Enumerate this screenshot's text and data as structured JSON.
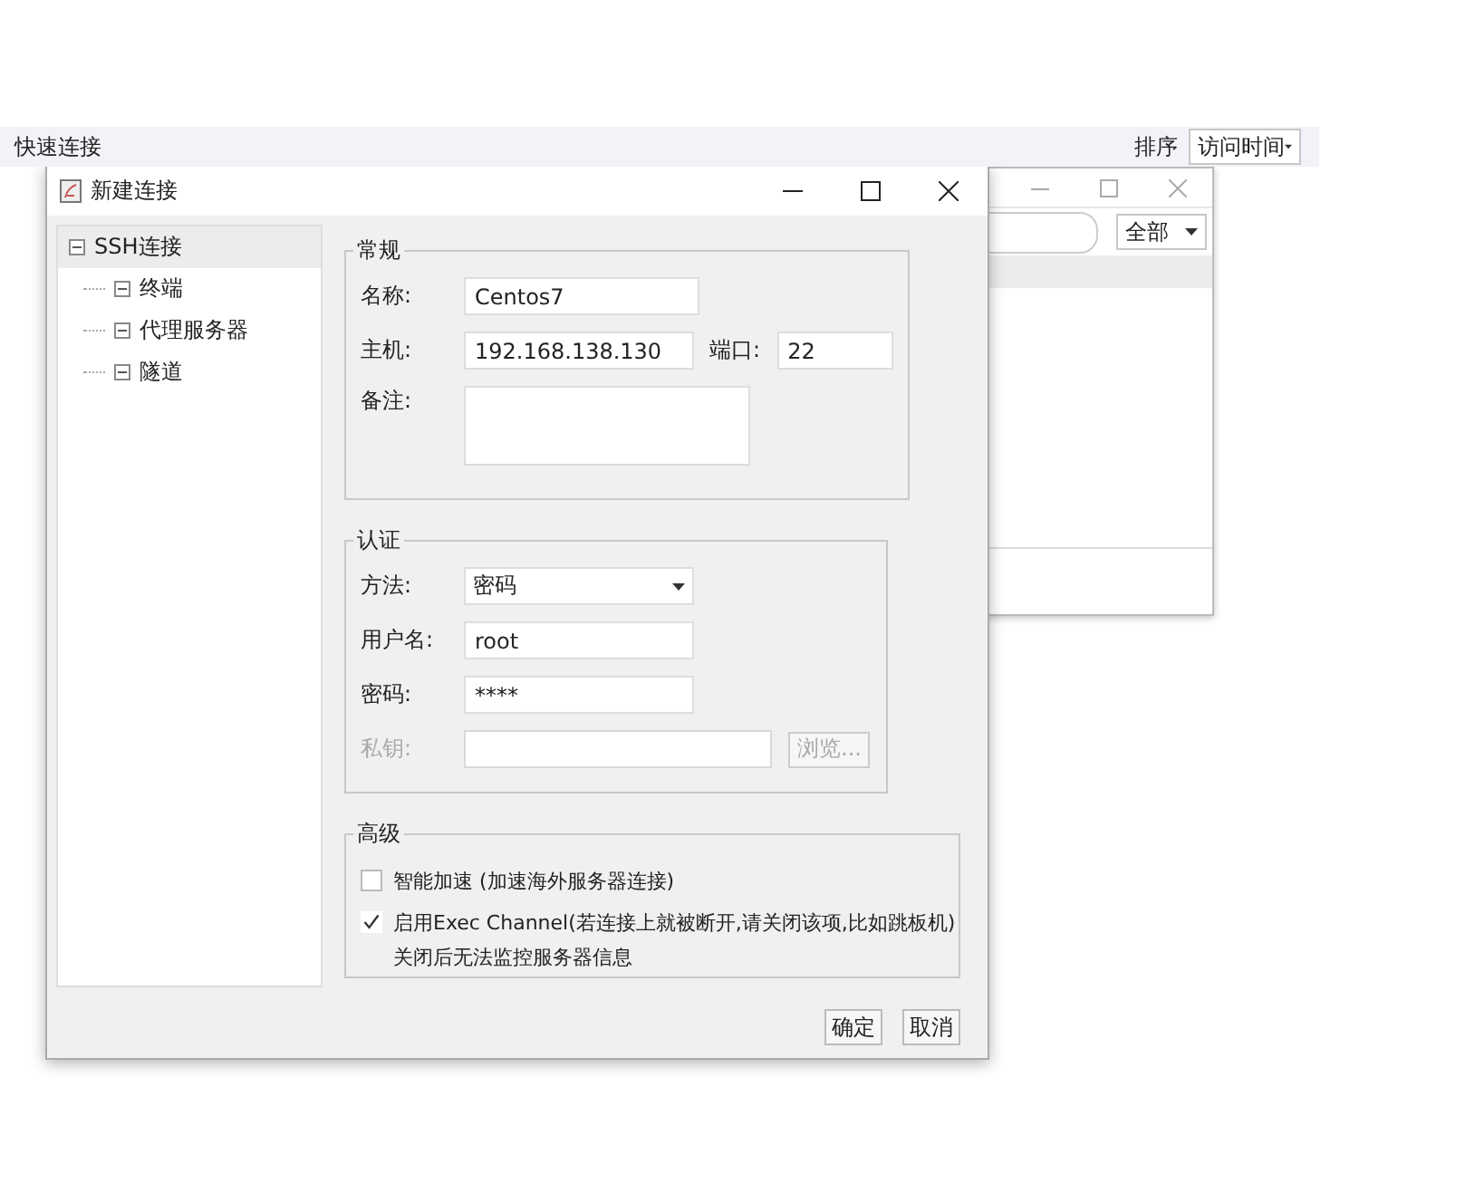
{
  "top_bar": {
    "title": "快速连接",
    "sort_label": "排序",
    "sort_value": "访问时间"
  },
  "back_window": {
    "filter_value": "全部"
  },
  "dialog": {
    "title": "新建连接",
    "tree": [
      {
        "label": "SSH连接",
        "selected": true,
        "children": [
          {
            "label": "终端",
            "selected": false
          },
          {
            "label": "代理服务器",
            "selected": false
          },
          {
            "label": "隧道",
            "selected": false
          }
        ]
      }
    ],
    "general": {
      "legend": "常规",
      "name_label": "名称:",
      "name_value": "Centos7",
      "host_label": "主机:",
      "host_value": "192.168.138.130",
      "port_label": "端口:",
      "port_value": "22",
      "note_label": "备注:"
    },
    "auth": {
      "legend": "认证",
      "method_label": "方法:",
      "method_value": "密码",
      "user_label": "用户名:",
      "user_value": "root",
      "password_label": "密码:",
      "password_value": "****",
      "key_label": "私钥:",
      "key_disabled": true,
      "browse_label": "浏览..."
    },
    "advanced": {
      "legend": "高级",
      "options": [
        {
          "label": "智能加速 (加速海外服务器连接)",
          "checked": false
        },
        {
          "label": "启用Exec Channel(若连接上就被断开,请关闭该项,比如跳板机)",
          "checked": true
        }
      ],
      "note": "关闭后无法监控服务器信息"
    },
    "buttons": [
      "确定",
      "取消"
    ]
  }
}
